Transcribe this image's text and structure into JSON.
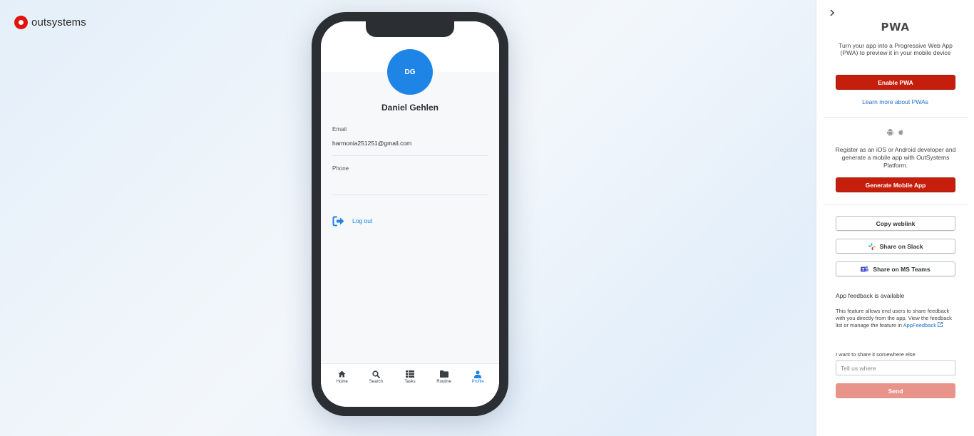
{
  "brand": {
    "name": "outsystems"
  },
  "phone": {
    "avatar_initials": "DG",
    "profile_name": "Daniel Gehlen",
    "fields": [
      {
        "label": "Email",
        "value": "harmonia251251@gmail.com"
      },
      {
        "label": "Phone",
        "value": ""
      }
    ],
    "logout_label": "Log out",
    "nav": [
      {
        "label": "Home",
        "icon": "home-icon"
      },
      {
        "label": "Search",
        "icon": "search-icon"
      },
      {
        "label": "Tasks",
        "icon": "list-icon"
      },
      {
        "label": "Routine",
        "icon": "folder-icon"
      },
      {
        "label": "Profile",
        "icon": "user-icon",
        "active": true
      }
    ]
  },
  "panel": {
    "pwa_logo": "PWA",
    "pwa_description": "Turn your app into a Progressive Web App (PWA) to preview it in your mobile device",
    "enable_pwa_label": "Enable PWA",
    "learn_more_label": "Learn more about PWAs",
    "register_description": "Register as an iOS or Android developer and generate a mobile app with OutSystems Platform.",
    "generate_app_label": "Generate Mobile App",
    "copy_weblink_label": "Copy weblink",
    "share_slack_label": "Share on Slack",
    "share_teams_label": "Share on MS Teams",
    "feedback_title": "App feedback is available",
    "feedback_text": "This feature allows end users to share feedback with you directly from the app. View the feedback list or manage the feature in",
    "feedback_link": "AppFeedback",
    "share_elsewhere_label": "I want to share it somewhere else",
    "share_elsewhere_placeholder": "Tell us where",
    "send_label": "Send"
  },
  "colors": {
    "brand_red": "#e3120b",
    "primary_red": "#c51e0c",
    "accent_blue": "#1e84e6",
    "send_disabled": "#e8948a"
  }
}
